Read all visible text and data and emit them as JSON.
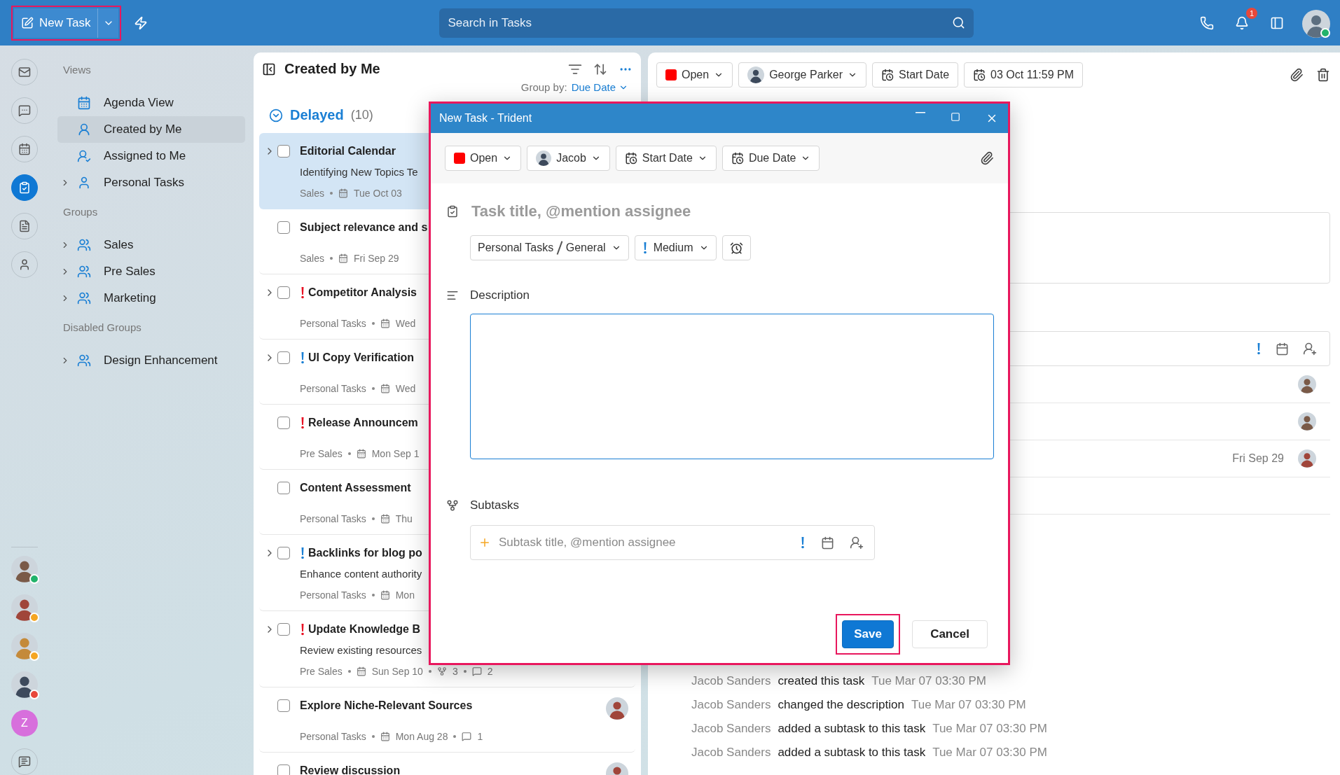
{
  "top_bar": {
    "new_task": {
      "label": "New Task",
      "highlighted": true
    },
    "search": {
      "placeholder": "Search in Tasks"
    },
    "notification_count": "1"
  },
  "rail": {
    "apps": [
      {
        "kind": "mail",
        "selected": false
      },
      {
        "kind": "chat",
        "selected": false
      },
      {
        "kind": "calendar",
        "selected": false
      },
      {
        "kind": "tasks",
        "selected": true
      },
      {
        "kind": "notes",
        "selected": false
      },
      {
        "kind": "contacts",
        "selected": false
      }
    ],
    "people": [
      {
        "kind": "photo",
        "color": "#22b36b"
      },
      {
        "kind": "photo",
        "color": "#f5a623"
      },
      {
        "kind": "photo",
        "color": "#f5a623"
      },
      {
        "kind": "photo",
        "color": "#e8483b"
      },
      {
        "kind": "initial",
        "initial": "Z"
      }
    ]
  },
  "nav": {
    "sections": [
      {
        "heading": "Views",
        "items": [
          {
            "label": "Agenda View",
            "expandable": false,
            "selected": false
          },
          {
            "label": "Created by Me",
            "expandable": false,
            "selected": true
          },
          {
            "label": "Assigned to Me",
            "expandable": false,
            "selected": false
          },
          {
            "label": "Personal Tasks",
            "expandable": true,
            "selected": false
          }
        ]
      },
      {
        "heading": "Groups",
        "items": [
          {
            "label": "Sales",
            "expandable": true,
            "selected": false
          },
          {
            "label": "Pre Sales",
            "expandable": true,
            "selected": false
          },
          {
            "label": "Marketing",
            "expandable": true,
            "selected": false
          }
        ]
      },
      {
        "heading": "Disabled Groups",
        "items": [
          {
            "label": "Design Enhancement",
            "expandable": true,
            "selected": false
          }
        ]
      }
    ]
  },
  "task_list": {
    "title": "Created by Me",
    "group_by_label": "Group by:",
    "group_by_value": "Due Date",
    "section": {
      "label": "Delayed",
      "count": "(10)",
      "expanded": true
    },
    "tasks": [
      {
        "title": "Editorial Calendar",
        "kind": "plain",
        "has_subtasks": true,
        "checked": false,
        "selected": true,
        "description": "Identifying New Topics Te",
        "group": "Sales",
        "date": "Tue Oct 03"
      },
      {
        "title": "Subject relevance and s",
        "kind": "plain",
        "has_subtasks": false,
        "checked": false,
        "selected": false,
        "group": "Sales",
        "date": "Fri Sep 29"
      },
      {
        "title": "Competitor Analysis",
        "kind": "high",
        "has_subtasks": true,
        "checked": false,
        "selected": false,
        "group": "Personal Tasks",
        "date": "Wed"
      },
      {
        "title": "UI Copy Verification",
        "kind": "medium",
        "has_subtasks": true,
        "checked": false,
        "selected": false,
        "group": "Personal Tasks",
        "date": "Wed"
      },
      {
        "title": "Release Announcem",
        "kind": "high",
        "has_subtasks": false,
        "checked": false,
        "selected": false,
        "group": "Pre Sales",
        "date": "Mon Sep 1"
      },
      {
        "title": "Content Assessment",
        "kind": "plain",
        "has_subtasks": false,
        "checked": false,
        "selected": false,
        "group": "Personal Tasks",
        "date": "Thu"
      },
      {
        "title": "Backlinks for blog po",
        "kind": "medium",
        "has_subtasks": true,
        "checked": false,
        "selected": false,
        "description": "Enhance content authority",
        "group": "Personal Tasks",
        "date": "Mon"
      },
      {
        "title": "Update Knowledge B",
        "kind": "high",
        "has_subtasks": true,
        "checked": false,
        "selected": false,
        "description": "Review existing resources",
        "group": "Pre Sales",
        "date": "Sun Sep 10",
        "subtasks": "3",
        "comments": "2"
      },
      {
        "title": "Explore Niche-Relevant Sources",
        "kind": "plain",
        "has_subtasks": false,
        "checked": false,
        "selected": false,
        "group": "Personal Tasks",
        "date": "Mon Aug 28",
        "comments": "1",
        "avatar": true
      },
      {
        "title": "Review discussion",
        "kind": "plain",
        "has_subtasks": false,
        "checked": false,
        "selected": false,
        "avatar": true
      }
    ]
  },
  "detail": {
    "status": "Open",
    "assignee": "George Parker",
    "start": "Start Date",
    "due": "03 Oct 11:59 PM",
    "subtask_rows": [
      {
        "avatar": true
      },
      {
        "avatar": true
      },
      {
        "date": "Fri Sep 29",
        "avatar": true
      },
      {
        "avatar": false
      }
    ],
    "timeline": [
      {
        "actor": "Jacob Sanders",
        "action": "created this task",
        "time": "Tue Mar 07 03:30 PM"
      },
      {
        "actor": "Jacob Sanders",
        "action": "changed the description",
        "time": "Tue Mar 07 03:30 PM"
      },
      {
        "actor": "Jacob Sanders",
        "action": "added a subtask to this task",
        "time": "Tue Mar 07 03:30 PM"
      },
      {
        "actor": "Jacob Sanders",
        "action": "added a subtask to this task",
        "time": "Tue Mar 07 03:30 PM"
      }
    ]
  },
  "dialog": {
    "title": "New Task - Trident",
    "status": "Open",
    "assignee": "Jacob",
    "start": "Start Date",
    "due": "Due Date",
    "title_placeholder": "Task title, @mention assignee",
    "list": "Personal Tasks",
    "bucket": "General",
    "priority": {
      "label": "Medium",
      "kind": "medium"
    },
    "description_label": "Description",
    "subtasks_label": "Subtasks",
    "subtask_placeholder": "Subtask title, @mention assignee",
    "buttons": [
      {
        "label": "Save",
        "kind": "primary",
        "highlighted": true
      },
      {
        "label": "Cancel",
        "kind": "secondary",
        "highlighted": false
      }
    ]
  }
}
